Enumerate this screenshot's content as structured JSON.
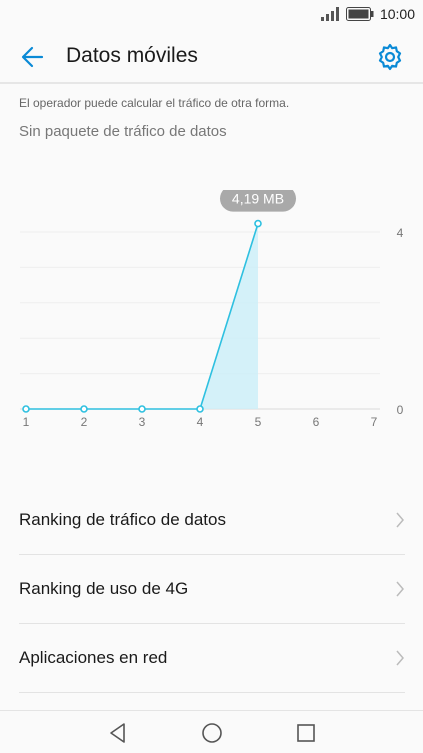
{
  "status_bar": {
    "time": "10:00",
    "icons": [
      "signal-icon",
      "battery-icon"
    ]
  },
  "header": {
    "title": "Datos móviles",
    "back_icon": "arrow-back-icon",
    "settings_icon": "gear-icon"
  },
  "note": "El operador puede calcular el tráfico de otra forma.",
  "package_text": "Sin paquete de tráfico de datos",
  "colors": {
    "accent": "#0a8ad6",
    "line": "#2ec0e0",
    "fill": "#cdeef8",
    "tooltip_bg": "#a9a9a9"
  },
  "chart_data": {
    "type": "line",
    "x": [
      1,
      2,
      3,
      4,
      5
    ],
    "x_ticks": [
      "1",
      "2",
      "3",
      "4",
      "5",
      "6",
      "7"
    ],
    "values": [
      0,
      0,
      0,
      0,
      4.19
    ],
    "xlim": [
      1,
      7
    ],
    "ylim": [
      0,
      4
    ],
    "y_ticks": [
      "0",
      "4"
    ],
    "tooltip": "4,19 MB",
    "grid": true
  },
  "list": [
    {
      "label": "Ranking de tráfico de datos"
    },
    {
      "label": "Ranking de uso de 4G"
    },
    {
      "label": "Aplicaciones en red"
    }
  ],
  "nav": [
    "back-nav-icon",
    "home-nav-icon",
    "recents-nav-icon"
  ]
}
